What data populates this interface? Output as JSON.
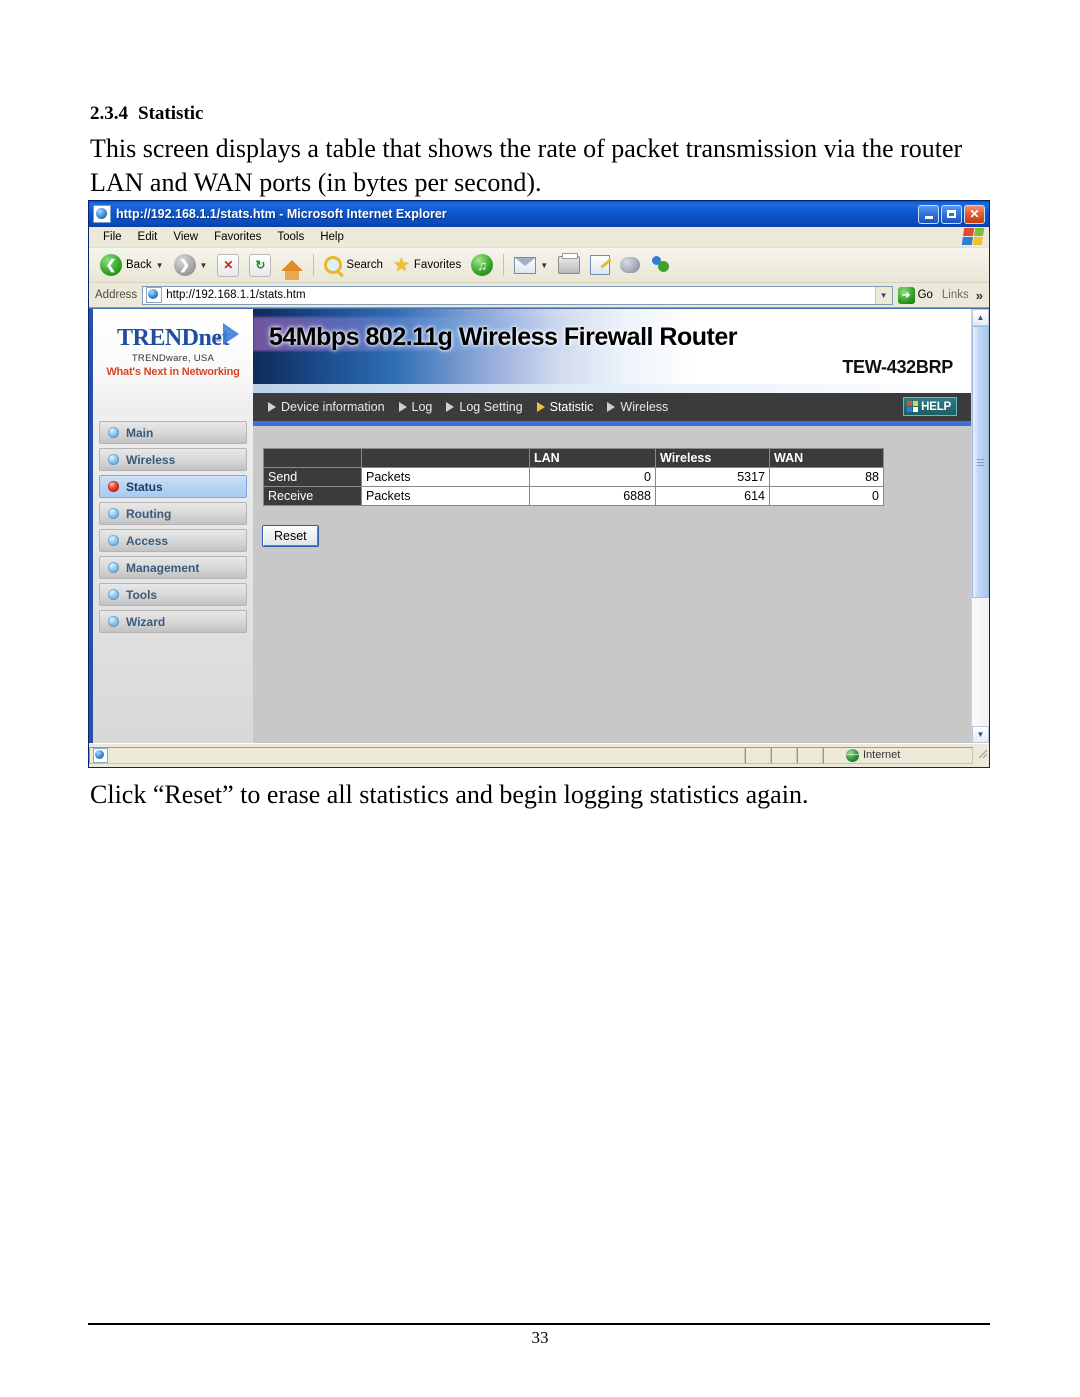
{
  "document": {
    "heading_number": "2.3.4",
    "heading_title": "Statistic",
    "paragraph": "This screen displays a table that shows the rate of packet transmission via the router LAN and WAN ports (in bytes per second).",
    "caption": "Click “Reset” to erase all statistics and begin logging statistics again.",
    "page_number": "33"
  },
  "browser": {
    "title": "http://192.168.1.1/stats.htm - Microsoft Internet Explorer",
    "window_buttons": {
      "minimize": "Minimize",
      "maximize": "Maximize",
      "close": "Close"
    },
    "menu": [
      {
        "label": "File"
      },
      {
        "label": "Edit"
      },
      {
        "label": "View"
      },
      {
        "label": "Favorites"
      },
      {
        "label": "Tools"
      },
      {
        "label": "Help"
      }
    ],
    "toolbar": {
      "back": "Back",
      "forward": "Forward",
      "stop": "Stop",
      "refresh": "Refresh",
      "home": "Home",
      "search": "Search",
      "favorites": "Favorites",
      "media": "Media",
      "mail": "Mail",
      "print": "Print",
      "edit": "Edit",
      "discuss": "Discuss",
      "messenger": "Messenger"
    },
    "address": {
      "label": "Address",
      "value": "http://192.168.1.1/stats.htm",
      "go_label": "Go",
      "links_label": "Links"
    },
    "status": {
      "zone": "Internet"
    }
  },
  "router_ui": {
    "logo": {
      "brand": "TRENDnet",
      "company": "TRENDware, USA",
      "tagline": "What's Next in Networking"
    },
    "banner": {
      "title": "54Mbps 802.11g Wireless Firewall Router",
      "model": "TEW-432BRP"
    },
    "nav_tabs": [
      {
        "label": "Device information",
        "active": false
      },
      {
        "label": "Log",
        "active": false
      },
      {
        "label": "Log Setting",
        "active": false
      },
      {
        "label": "Statistic",
        "active": true
      },
      {
        "label": "Wireless",
        "active": false
      }
    ],
    "help_button": "HELP",
    "sidebar": [
      {
        "label": "Main",
        "active": false
      },
      {
        "label": "Wireless",
        "active": false
      },
      {
        "label": "Status",
        "active": true
      },
      {
        "label": "Routing",
        "active": false
      },
      {
        "label": "Access",
        "active": false
      },
      {
        "label": "Management",
        "active": false
      },
      {
        "label": "Tools",
        "active": false
      },
      {
        "label": "Wizard",
        "active": false
      }
    ],
    "stats_table": {
      "headers": [
        "",
        "",
        "LAN",
        "Wireless",
        "WAN"
      ],
      "rows": [
        {
          "direction": "Send",
          "unit": "Packets",
          "lan": "0",
          "wireless": "5317",
          "wan": "88"
        },
        {
          "direction": "Receive",
          "unit": "Packets",
          "lan": "6888",
          "wireless": "614",
          "wan": "0"
        }
      ]
    },
    "reset_button": "Reset"
  },
  "colors": {
    "accent_blue": "#3f6fd8",
    "navbar_dark": "#3b3b3b",
    "brand_blue": "#1f4e9c",
    "tagline_red": "#d8442a",
    "active_tab_arrow": "#f2c02a",
    "content_gray": "#c8c8c8"
  }
}
